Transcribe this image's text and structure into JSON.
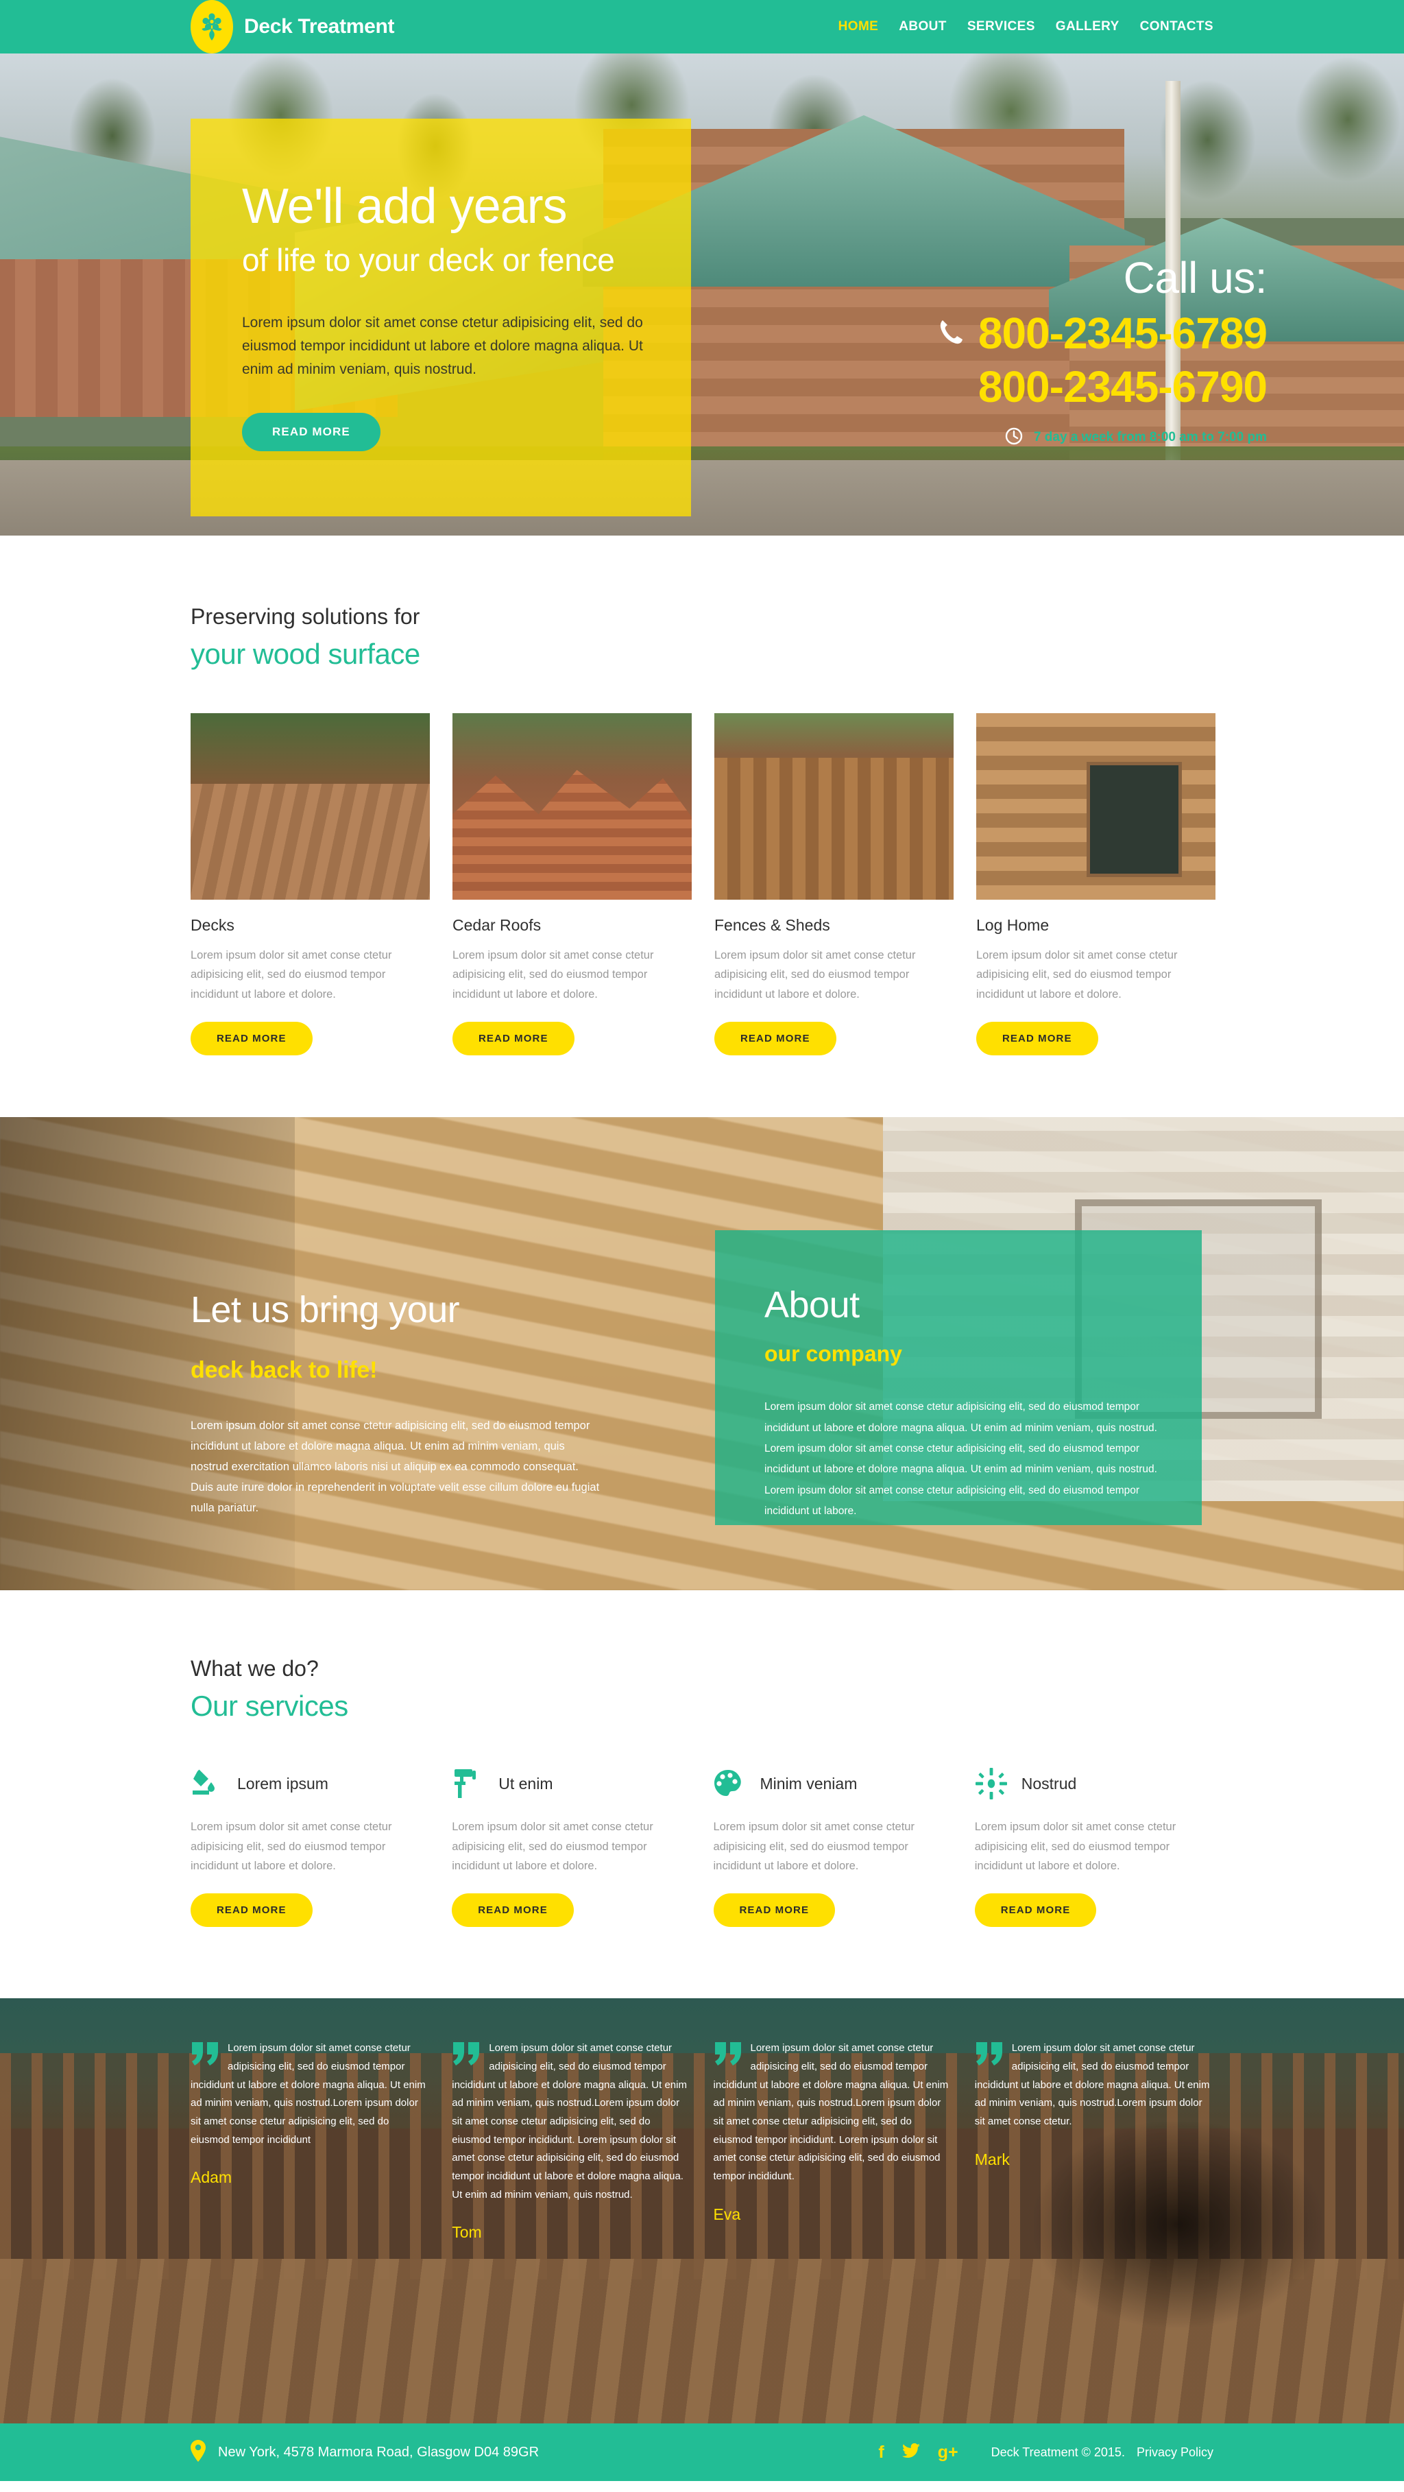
{
  "colors": {
    "teal": "#22bd95",
    "yellow": "#ffe000",
    "panel_teal": "#1eb288",
    "dark_text": "#2f2f2f",
    "muted_text": "#9a9a9a"
  },
  "header": {
    "logo_text": "Deck Treatment",
    "logo_icon": "flower-icon",
    "nav": [
      {
        "label": "HOME",
        "active": true
      },
      {
        "label": "ABOUT",
        "active": false
      },
      {
        "label": "SERVICES",
        "active": false
      },
      {
        "label": "GALLERY",
        "active": false
      },
      {
        "label": "CONTACTS",
        "active": false
      }
    ]
  },
  "hero": {
    "headline": "We'll add years",
    "subheadline": "of life to your deck or fence",
    "paragraph": "Lorem ipsum dolor sit amet conse ctetur adipisicing elit, sed do eiusmod tempor incididunt ut labore et dolore magna aliqua. Ut enim ad minim veniam, quis nostrud.",
    "cta_label": "READ MORE",
    "call": {
      "title": "Call us:",
      "phone_icon": "phone-icon",
      "phone1": "800-2345-6789",
      "phone2": "800-2345-6790",
      "clock_icon": "clock-icon",
      "hours": "7 day a week from 8:00 am  to  7:00 pm"
    }
  },
  "preserving": {
    "sub_title": "Preserving solutions for",
    "main_title": "your wood surface",
    "cards": [
      {
        "title": "Decks",
        "text": "Lorem ipsum dolor sit amet conse ctetur adipisicing elit, sed do eiusmod tempor incididunt ut labore et dolore.",
        "button": "READ MORE",
        "image": "deck-photo"
      },
      {
        "title": "Cedar Roofs",
        "text": "Lorem ipsum dolor sit amet conse ctetur adipisicing elit, sed do eiusmod tempor incididunt ut labore et dolore.",
        "button": "READ MORE",
        "image": "cedar-roof-photo"
      },
      {
        "title": "Fences & Sheds",
        "text": "Lorem ipsum dolor sit amet conse ctetur adipisicing elit, sed do eiusmod tempor incididunt ut labore et dolore.",
        "button": "READ MORE",
        "image": "fence-photo"
      },
      {
        "title": "Log Home",
        "text": "Lorem ipsum dolor sit amet conse ctetur adipisicing elit, sed do eiusmod tempor incididunt ut labore et dolore.",
        "button": "READ MORE",
        "image": "log-home-photo"
      }
    ]
  },
  "about": {
    "left_headline": "Let us bring your",
    "left_accent": "deck back to life!",
    "left_paragraph": "Lorem ipsum dolor sit amet conse ctetur adipisicing elit, sed do eiusmod tempor incididunt ut labore et dolore magna aliqua. Ut enim ad minim veniam, quis nostrud exercitation ullamco laboris nisi ut aliquip ex ea commodo consequat. Duis aute irure dolor in reprehenderit in voluptate velit esse cillum dolore eu fugiat nulla pariatur.",
    "panel_title": "About",
    "panel_subtitle": "our company",
    "panel_paragraph": "Lorem ipsum dolor sit amet conse ctetur adipisicing elit, sed do eiusmod tempor incididunt ut labore et dolore magna aliqua. Ut enim ad minim veniam, quis nostrud. Lorem ipsum dolor sit amet conse ctetur adipisicing elit, sed do eiusmod tempor incididunt ut labore et dolore magna aliqua. Ut enim ad minim veniam, quis nostrud. Lorem ipsum dolor sit amet conse ctetur adipisicing elit, sed do eiusmod tempor incididunt ut labore."
  },
  "services": {
    "sub_title": "What we do?",
    "main_title": "Our services",
    "items": [
      {
        "icon": "paint-pour-icon",
        "name": "Lorem ipsum",
        "text": "Lorem ipsum dolor sit amet conse ctetur adipisicing elit, sed do eiusmod tempor incididunt ut labore et dolore.",
        "button": "READ MORE"
      },
      {
        "icon": "paint-roller-icon",
        "name": "Ut enim",
        "text": "Lorem ipsum dolor sit amet conse ctetur adipisicing elit, sed do eiusmod tempor incididunt ut labore et dolore.",
        "button": "READ MORE"
      },
      {
        "icon": "palette-icon",
        "name": "Minim veniam",
        "text": "Lorem ipsum dolor sit amet conse ctetur adipisicing elit, sed do eiusmod tempor incididunt ut labore et dolore.",
        "button": "READ MORE"
      },
      {
        "icon": "sun-brightness-icon",
        "name": "Nostrud",
        "text": "Lorem ipsum dolor sit amet conse ctetur adipisicing elit, sed do eiusmod tempor incididunt ut labore et dolore.",
        "button": "READ MORE"
      }
    ]
  },
  "testimonials": [
    {
      "quote_icon": "quote-icon",
      "text": "Lorem ipsum dolor sit amet conse ctetur adipisicing elit, sed do eiusmod tempor incididunt ut labore et dolore magna aliqua. Ut enim ad minim veniam, quis nostrud.Lorem ipsum dolor sit amet conse ctetur adipisicing elit, sed do eiusmod tempor incididunt",
      "name": "Adam"
    },
    {
      "quote_icon": "quote-icon",
      "text": "Lorem ipsum dolor sit amet conse ctetur adipisicing elit, sed do eiusmod tempor incididunt ut labore et dolore magna aliqua. Ut enim ad minim veniam, quis nostrud.Lorem ipsum dolor sit amet conse ctetur adipisicing elit, sed do eiusmod tempor incididunt. Lorem ipsum dolor sit amet conse ctetur adipisicing elit, sed do eiusmod tempor incididunt ut labore et dolore magna aliqua. Ut enim ad minim veniam, quis nostrud.",
      "name": "Tom"
    },
    {
      "quote_icon": "quote-icon",
      "text": "Lorem ipsum dolor sit amet conse ctetur adipisicing elit, sed do eiusmod tempor incididunt ut labore et dolore magna aliqua. Ut enim ad minim veniam, quis nostrud.Lorem ipsum dolor sit amet conse ctetur adipisicing elit, sed do eiusmod tempor incididunt. Lorem ipsum dolor sit amet conse ctetur adipisicing elit, sed do eiusmod tempor incididunt.",
      "name": "Eva"
    },
    {
      "quote_icon": "quote-icon",
      "text": "Lorem ipsum dolor sit amet conse ctetur adipisicing elit, sed do eiusmod tempor incididunt ut labore et dolore magna aliqua. Ut enim ad minim veniam, quis nostrud.Lorem ipsum dolor sit amet conse ctetur.",
      "name": "Mark"
    }
  ],
  "footer": {
    "pin_icon": "location-pin-icon",
    "address": "New York, 4578 Marmora Road, Glasgow D04 89GR",
    "social": [
      {
        "icon": "facebook-icon",
        "glyph": "f"
      },
      {
        "icon": "twitter-icon",
        "glyph": "ᵛ"
      },
      {
        "icon": "google-plus-icon",
        "glyph": "g+"
      }
    ],
    "copyright": "Deck Treatment © 2015.",
    "privacy_label": "Privacy Policy"
  }
}
